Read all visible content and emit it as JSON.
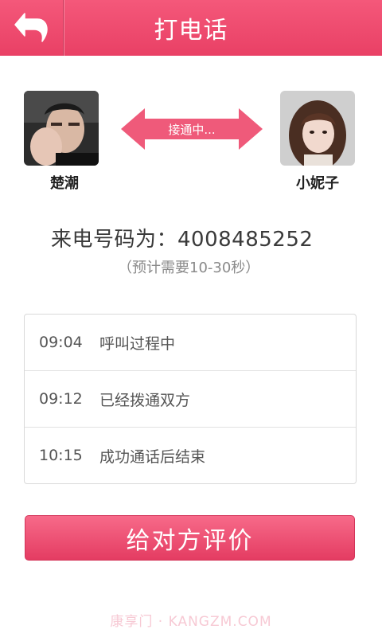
{
  "header": {
    "title": "打电话",
    "back_icon": "back-arrow-icon"
  },
  "caller": {
    "name": "楚潮"
  },
  "callee": {
    "name": "小妮子"
  },
  "status": {
    "label": "接通中..."
  },
  "number": {
    "label": "来电号码为：4008485252",
    "hint": "（预计需要10-30秒）"
  },
  "log": [
    {
      "time": "09:04",
      "text": "呼叫过程中"
    },
    {
      "time": "09:12",
      "text": "已经拨通双方"
    },
    {
      "time": "10:15",
      "text": "成功通话后结束"
    }
  ],
  "rate_button": {
    "label": "给对方评价"
  },
  "watermark": "康享门 · KANGZM.COM",
  "colors": {
    "brand": "#ee4a6f",
    "arrow": "#ef5a7a"
  }
}
